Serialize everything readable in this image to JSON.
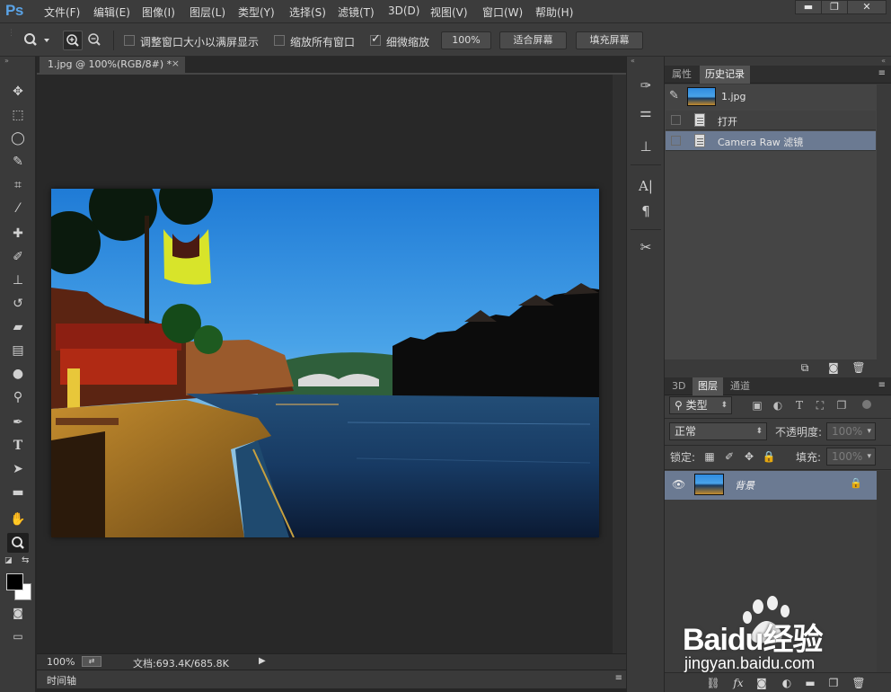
{
  "app": {
    "logo": "Ps"
  },
  "menu": [
    "文件(F)",
    "编辑(E)",
    "图像(I)",
    "图层(L)",
    "类型(Y)",
    "选择(S)",
    "滤镜(T)",
    "3D(D)",
    "视图(V)",
    "窗口(W)",
    "帮助(H)"
  ],
  "window_controls": {
    "minimize": "▬",
    "restore": "❐",
    "close": "✕"
  },
  "options": {
    "zoom_tool_icon": "magnifier-icon",
    "resize_windows_label": "调整窗口大小以满屏显示",
    "resize_windows_checked": false,
    "zoom_all_label": "缩放所有窗口",
    "zoom_all_checked": false,
    "scrubby_zoom_label": "细微缩放",
    "scrubby_zoom_checked": true,
    "btn_100": "100%",
    "btn_fit": "适合屏幕",
    "btn_fill": "填充屏幕"
  },
  "document": {
    "tab_title": "1.jpg @ 100%(RGB/8#) *",
    "tab_close": "×",
    "zoom_level": "100%",
    "doc_size": "文档:693.4K/685.8K"
  },
  "timeline": {
    "label": "时间轴"
  },
  "history_panel": {
    "tabs": [
      "属性",
      "历史记录"
    ],
    "active_tab": "历史记录",
    "snapshot_name": "1.jpg",
    "steps": [
      {
        "label": "打开",
        "selected": false
      },
      {
        "label": "Camera Raw 滤镜",
        "selected": true
      }
    ]
  },
  "layers_panel": {
    "tabs": [
      "3D",
      "图层",
      "通道"
    ],
    "active_tab": "图层",
    "filter_kind": "类型",
    "blend_mode": "正常",
    "opacity_label": "不透明度:",
    "opacity_value": "100%",
    "lock_label": "锁定:",
    "fill_label": "填充:",
    "fill_value": "100%",
    "layers": [
      {
        "name": "背景",
        "visible": true,
        "locked": true
      }
    ]
  },
  "watermark": {
    "brand": "Baidu经验",
    "url": "jingyan.baidu.com"
  }
}
